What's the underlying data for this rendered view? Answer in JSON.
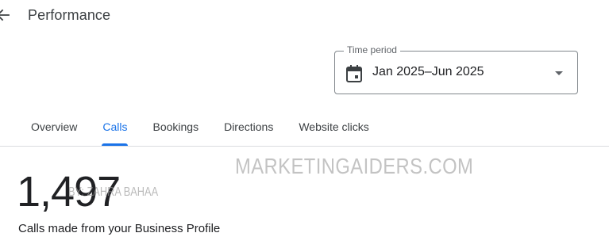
{
  "header": {
    "title": "Performance",
    "back_icon": "arrow-back-icon"
  },
  "time_period": {
    "label": "Time period",
    "value": "Jan 2025–Jun 2025",
    "icon": "calendar-icon",
    "dropdown_icon": "arrow-drop-down-icon"
  },
  "tabs": [
    {
      "label": "Overview",
      "active": false
    },
    {
      "label": "Calls",
      "active": true
    },
    {
      "label": "Bookings",
      "active": false
    },
    {
      "label": "Directions",
      "active": false
    },
    {
      "label": "Website clicks",
      "active": false
    }
  ],
  "metric": {
    "value": "1,497",
    "description": "Calls made from your Business Profile"
  },
  "watermarks": {
    "main": "MARKETINGAIDERS.COM",
    "secondary": "BY: ZAHRA BAHAA"
  },
  "colors": {
    "accent": "#1a73e8",
    "text_primary": "#202124",
    "text_secondary": "#3c4043",
    "border": "#80868b",
    "divider": "#dadce0"
  }
}
